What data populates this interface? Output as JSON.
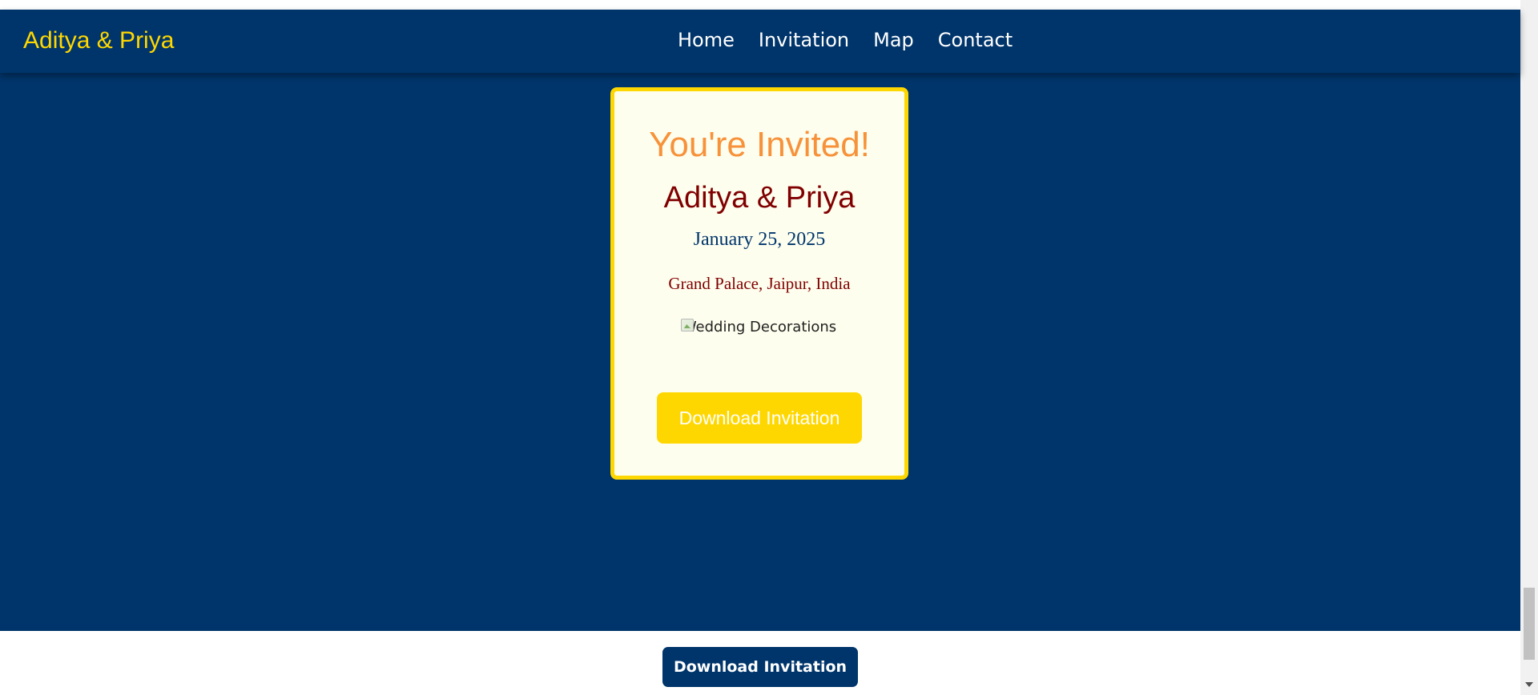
{
  "navbar": {
    "brand": "Aditya & Priya",
    "links": [
      {
        "label": "Home"
      },
      {
        "label": "Invitation"
      },
      {
        "label": "Map"
      },
      {
        "label": "Contact"
      }
    ]
  },
  "invitation_card": {
    "title": "You're Invited!",
    "names": "Aditya & Priya",
    "date": "January 25, 2025",
    "venue": "Grand Palace, Jaipur, India",
    "image_alt": "Wedding Decorations",
    "download_label": "Download Invitation"
  },
  "footer": {
    "download_label": "Download Invitation"
  },
  "colors": {
    "navy": "#00356b",
    "gold": "#ffd700",
    "orange": "#f7923a",
    "maroon": "#800000",
    "card_bg": "#fefeee"
  }
}
